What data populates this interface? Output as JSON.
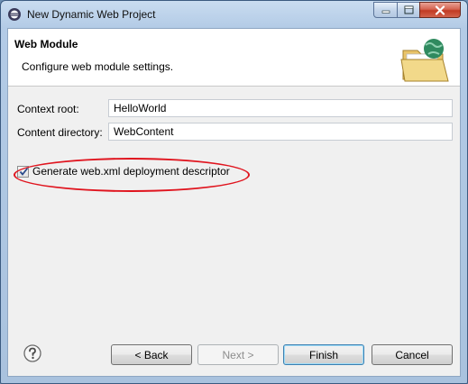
{
  "window": {
    "title": "New Dynamic Web Project",
    "controls": {
      "minimize": "minimize-icon",
      "maximize": "maximize-icon",
      "close": "close-icon"
    }
  },
  "banner": {
    "title": "Web Module",
    "description": "Configure web module settings.",
    "icon": "web-project-folder-icon"
  },
  "form": {
    "context_root": {
      "label": "Context root:",
      "value": "HelloWorld"
    },
    "content_directory": {
      "label": "Content directory:",
      "value": "WebContent"
    },
    "generate_descriptor": {
      "label": "Generate web.xml deployment descriptor",
      "checked": true
    }
  },
  "annotation": {
    "color": "#e0141e",
    "shape": "ellipse"
  },
  "footer": {
    "help_icon": "help-icon",
    "back": "< Back",
    "next": "Next >",
    "finish": "Finish",
    "cancel": "Cancel"
  }
}
